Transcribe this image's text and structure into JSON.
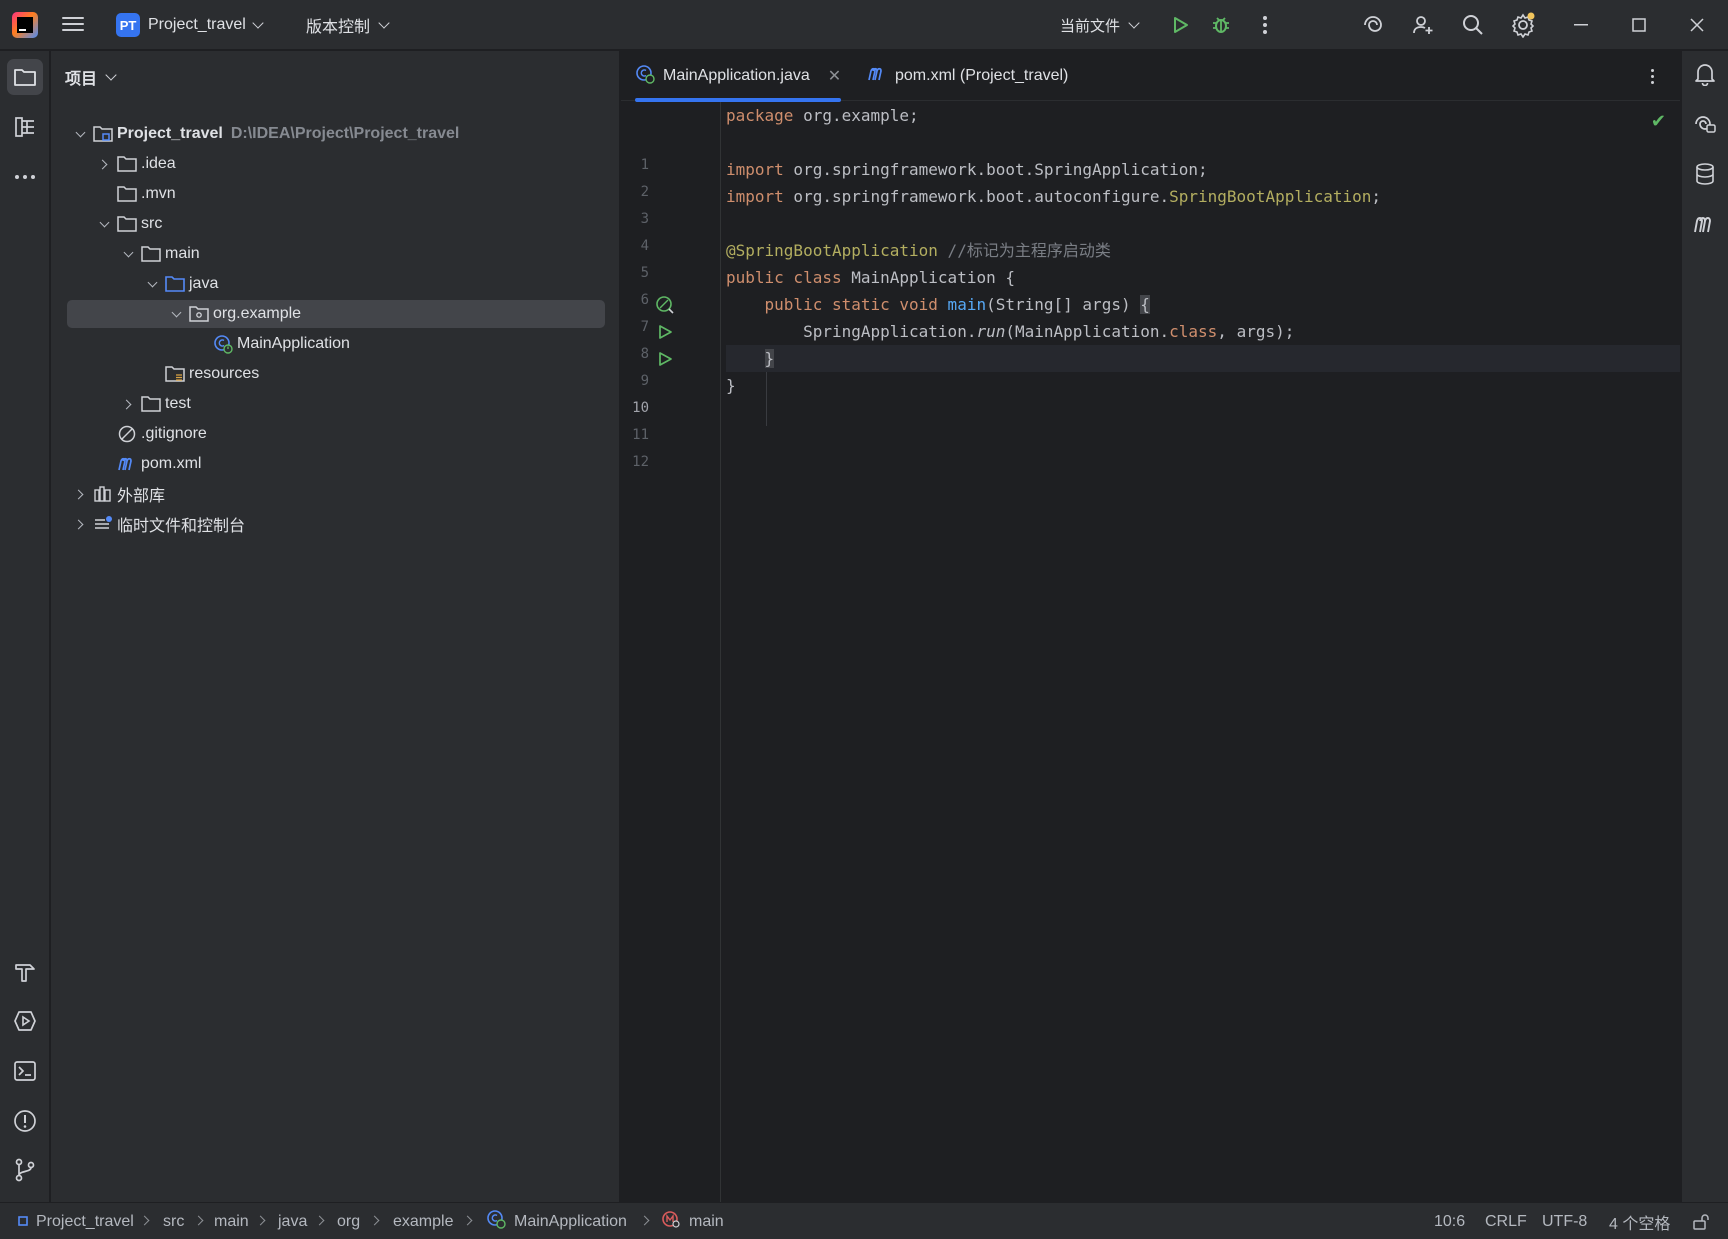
{
  "titlebar": {
    "project_badge": "PT",
    "project_name": "Project_travel",
    "vcs_label": "版本控制",
    "run_config": "当前文件"
  },
  "project_panel": {
    "header": "项目",
    "tree": [
      {
        "label": "Project_travel",
        "path": "D:\\IDEA\\Project\\Project_travel"
      },
      {
        "label": ".idea"
      },
      {
        "label": ".mvn"
      },
      {
        "label": "src"
      },
      {
        "label": "main"
      },
      {
        "label": "java"
      },
      {
        "label": "org.example"
      },
      {
        "label": "MainApplication"
      },
      {
        "label": "resources"
      },
      {
        "label": "test"
      },
      {
        "label": ".gitignore"
      },
      {
        "label": "pom.xml"
      },
      {
        "label": "外部库"
      },
      {
        "label": "临时文件和控制台"
      }
    ]
  },
  "editor": {
    "tabs": [
      {
        "label": "MainApplication.java",
        "active": true
      },
      {
        "label": "pom.xml (Project_travel)",
        "active": false
      }
    ],
    "current_line": 10,
    "line_numbers": [
      "1",
      "2",
      "3",
      "4",
      "5",
      "6",
      "7",
      "8",
      "9",
      "10",
      "11",
      "12"
    ],
    "code": {
      "l1_kw": "package",
      "l1_rest": " org.example;",
      "l3_kw": "import",
      "l3_rest": " org.springframework.boot.SpringApplication;",
      "l4_kw": "import",
      "l4_rest": " org.springframework.boot.autoconfigure.",
      "l4_ann": "SpringBootApplication",
      "l4_end": ";",
      "l6_ann": "@SpringBootApplication",
      "l6_comment": " //标记为主程序启动类",
      "l7_kw": "public class",
      "l7_rest": " MainApplication {",
      "l8_indent": "    ",
      "l8_kw": "public static void",
      "l8_fn": " main",
      "l8_rest": "(String[] args) ",
      "l8_brace": "{",
      "l9_indent": "        ",
      "l9_a": "SpringApplication.",
      "l9_run": "run",
      "l9_b": "(MainApplication.",
      "l9_kw": "class",
      "l9_c": ", args);",
      "l10_indent": "    ",
      "l10_brace": "}",
      "l11": "}"
    }
  },
  "statusbar": {
    "breadcrumbs": [
      "Project_travel",
      "src",
      "main",
      "java",
      "org",
      "example",
      "MainApplication",
      "main"
    ],
    "position": "10:6",
    "line_sep": "CRLF",
    "encoding": "UTF-8",
    "indent": "4 个空格"
  },
  "colors": {
    "accent": "#3574f0",
    "run_green": "#5fb865",
    "keyword": "#cf8e6d",
    "annotation": "#b3ae60",
    "function": "#56a8f5",
    "comment": "#7a7e85"
  },
  "icons": {
    "left_strip": [
      "folder-icon",
      "structure-icon",
      "more-icon",
      "build-icon",
      "run-icon",
      "terminal-icon",
      "problems-icon",
      "git-icon"
    ],
    "right_strip": [
      "notifications-icon",
      "ai-assistant-icon",
      "database-icon",
      "maven-icon"
    ]
  }
}
